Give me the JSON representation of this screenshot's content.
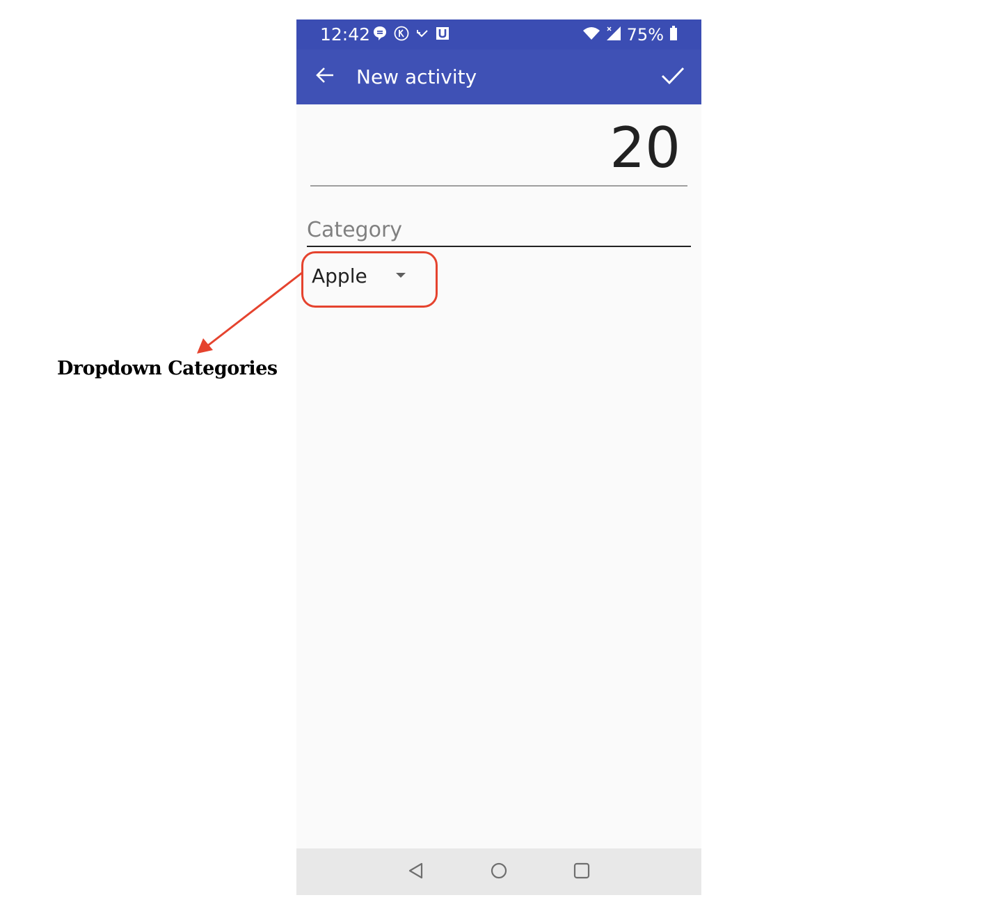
{
  "status_bar": {
    "time": "12:42",
    "battery_percent": "75%",
    "left_icons": [
      "chat-bubble-icon",
      "k-circle-icon",
      "missed-call-icon",
      "u-app-icon"
    ],
    "right_icons": [
      "wifi-icon",
      "signal-icon",
      "battery-icon"
    ]
  },
  "app_bar": {
    "title": "New activity",
    "back_icon": "arrow-back-icon",
    "confirm_icon": "check-icon",
    "background": "#3f51b5"
  },
  "form": {
    "amount_value": "20",
    "category_label": "Category",
    "category_selected": "Apple"
  },
  "nav_bar": {
    "buttons": [
      "back-triangle-icon",
      "home-circle-icon",
      "recents-square-icon"
    ]
  },
  "annotation": {
    "label": "Dropdown Categories",
    "color": "#e5432e"
  }
}
